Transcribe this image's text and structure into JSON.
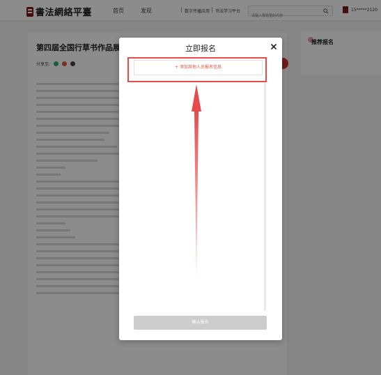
{
  "header": {
    "logo_text": "書法網絡平臺",
    "nav": [
      "首页",
      "发现"
    ],
    "links": [
      "数字传播应用",
      "书法学习平台"
    ],
    "separator": "|",
    "search_placeholder": "请输入展馆里的内容",
    "user_name": "15*****2120"
  },
  "article": {
    "title": "第四届全国行草书作品展",
    "share_label": "分享至:"
  },
  "sidebar": {
    "title": "推荐报名"
  },
  "modal": {
    "title": "立即报名",
    "close_symbol": "×",
    "add_button_label": "+ 添加其他人员报名信息",
    "confirm_button_label": "确认报名"
  },
  "colors": {
    "accent_red": "#e84b4b",
    "brand_dark_red": "#7a1a1a",
    "confirm_disabled": "#cccccc"
  }
}
